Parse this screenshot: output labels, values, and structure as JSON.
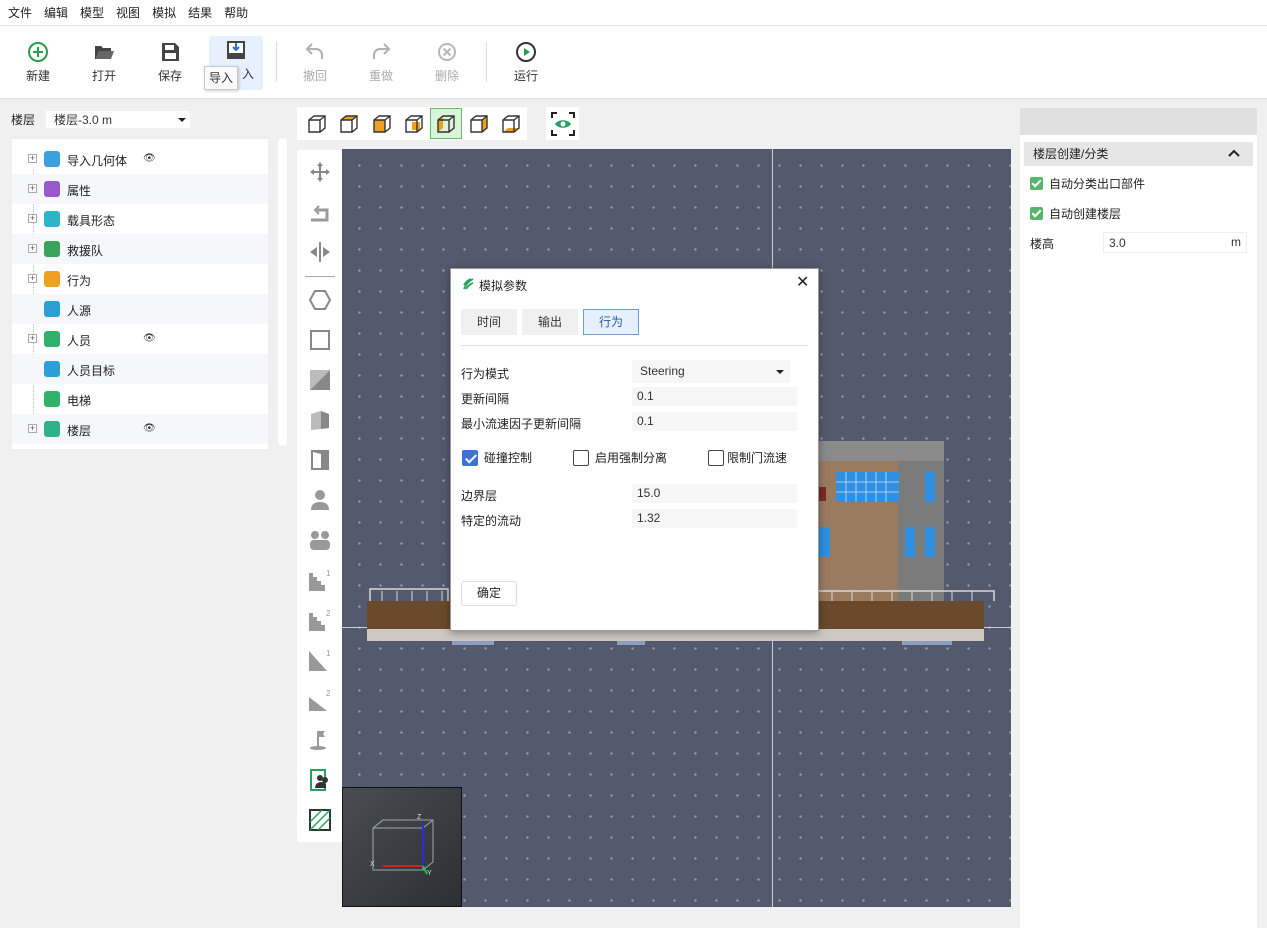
{
  "menu": [
    "文件",
    "编辑",
    "模型",
    "视图",
    "模拟",
    "结果",
    "帮助"
  ],
  "toolbar": {
    "new_label": "新建",
    "open_label": "打开",
    "save_label": "保存",
    "import_label": "入",
    "undo_label": "撤回",
    "redo_label": "重做",
    "delete_label": "删除",
    "run_label": "运行",
    "tooltip": "导入"
  },
  "floor": {
    "label": "楼层",
    "selected": "楼层-3.0 m"
  },
  "tree": {
    "items": [
      {
        "label": "导入几何体",
        "color": "#3aa0e0",
        "expandable": true,
        "visible_eye": true
      },
      {
        "label": "属性",
        "color": "#9b59d0",
        "expandable": true,
        "visible_eye": false
      },
      {
        "label": "载具形态",
        "color": "#2cb5c8",
        "expandable": true,
        "visible_eye": false
      },
      {
        "label": "救援队",
        "color": "#3aa35a",
        "expandable": true,
        "visible_eye": false
      },
      {
        "label": "行为",
        "color": "#f0a020",
        "expandable": true,
        "visible_eye": false
      },
      {
        "label": "人源",
        "color": "#2a9fd8",
        "expandable": false,
        "visible_eye": false
      },
      {
        "label": "人员",
        "color": "#2fb26a",
        "expandable": true,
        "visible_eye": true
      },
      {
        "label": "人员目标",
        "color": "#2a9fd8",
        "expandable": false,
        "visible_eye": false
      },
      {
        "label": "电梯",
        "color": "#2fb26a",
        "expandable": false,
        "visible_eye": false
      },
      {
        "label": "楼层",
        "color": "#2fb28a",
        "expandable": true,
        "visible_eye": true
      }
    ]
  },
  "right_panel": {
    "section_title": "楼层创建/分类",
    "auto_classify_label": "自动分类出口部件",
    "auto_create_label": "自动创建楼层",
    "floor_height_label": "楼高",
    "floor_height_value": "3.0",
    "floor_height_unit": "m",
    "check_color": "#58b66a"
  },
  "dialog": {
    "title": "模拟参数",
    "tabs": {
      "time": "时间",
      "output": "输出",
      "behavior": "行为"
    },
    "behavior_mode_label": "行为模式",
    "behavior_mode_value": "Steering",
    "update_interval_label": "更新间隔",
    "update_interval_value": "0.1",
    "min_flow_label": "最小流速因子更新间隔",
    "min_flow_value": "0.1",
    "collision_label": "碰撞控制",
    "collision_checked": true,
    "force_sep_label": "启用强制分离",
    "force_sep_checked": false,
    "door_flow_label": "限制门流速",
    "door_flow_checked": false,
    "boundary_label": "边界层",
    "boundary_value": "15.0",
    "specific_flow_label": "特定的流动",
    "specific_flow_value": "1.32",
    "ok_label": "确定",
    "accent": "#3f6fd8"
  },
  "minimap": {
    "z_label": "Z",
    "x_label": "X",
    "y_label": "Y"
  }
}
